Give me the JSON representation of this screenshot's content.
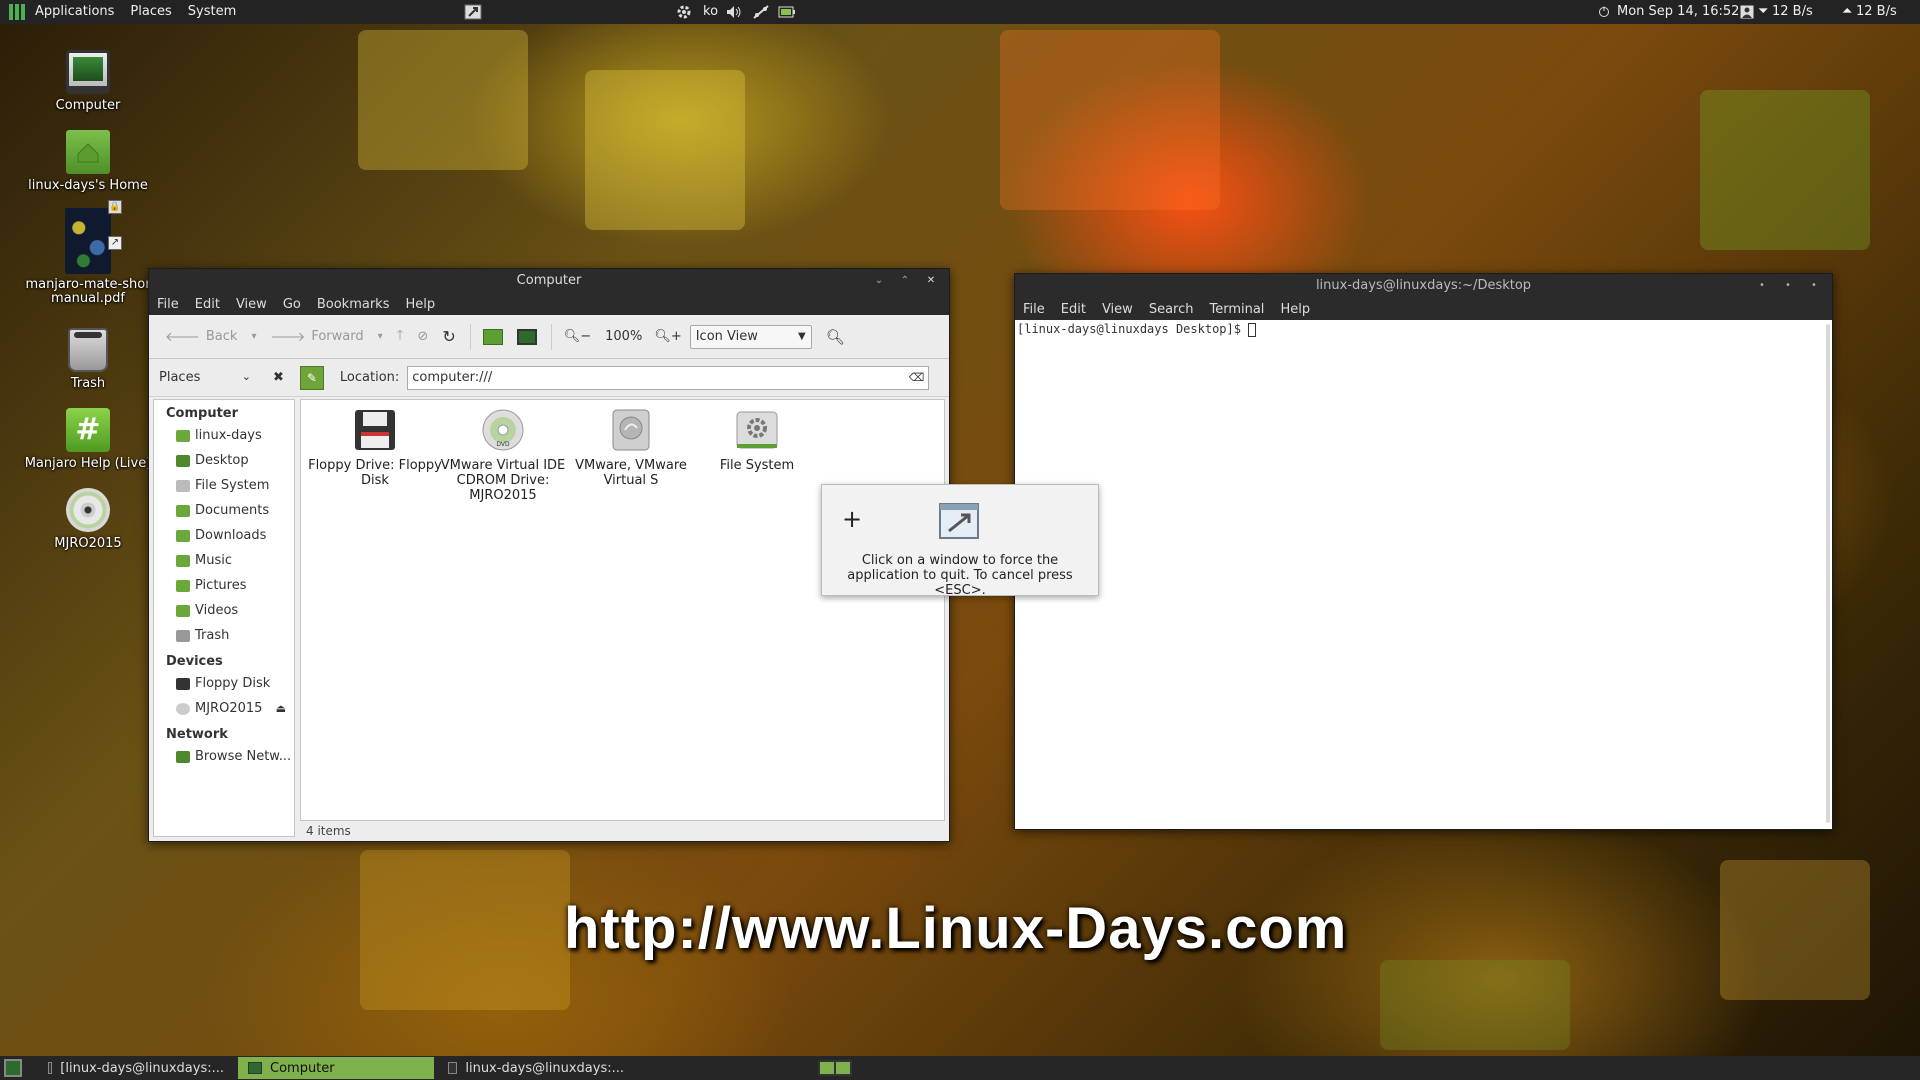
{
  "top_panel": {
    "menus": [
      "Applications",
      "Places",
      "System"
    ],
    "keyboard_layout": "ko",
    "clock": "Mon Sep 14, 16:52",
    "net_down": "12 B/s",
    "net_up": "12 B/s"
  },
  "desktop_icons": [
    {
      "label": "Computer"
    },
    {
      "label": "linux-days's Home"
    },
    {
      "label": "manjaro-mate-shortcuts-manual.pdf",
      "display": "manjaro-mate-shor\nmanual.pdf"
    },
    {
      "label": "Trash"
    },
    {
      "label": "Manjaro Help (Live)"
    },
    {
      "label": "MJRO2015"
    }
  ],
  "file_manager": {
    "title": "Computer",
    "menus": [
      "File",
      "Edit",
      "View",
      "Go",
      "Bookmarks",
      "Help"
    ],
    "toolbar": {
      "back": "Back",
      "forward": "Forward",
      "zoom": "100%",
      "view_mode": "Icon View"
    },
    "sidebar_selector": "Places",
    "location_label": "Location:",
    "location_value": "computer:///",
    "sidebar": {
      "computer_header": "Computer",
      "computer_items": [
        "linux-days",
        "Desktop",
        "File System",
        "Documents",
        "Downloads",
        "Music",
        "Pictures",
        "Videos",
        "Trash"
      ],
      "devices_header": "Devices",
      "device_items": [
        "Floppy Disk",
        "MJRO2015"
      ],
      "network_header": "Network",
      "network_items": [
        "Browse Netw..."
      ]
    },
    "files": [
      {
        "label": "Floppy Drive: Floppy Disk"
      },
      {
        "label": "VMware Virtual IDE CDROM Drive: MJRO2015"
      },
      {
        "label": "VMware, VMware Virtual S"
      },
      {
        "label": "File System"
      }
    ],
    "status": "4 items"
  },
  "force_quit_popup": {
    "text": "Click on a window to force the application to quit. To cancel press <ESC>."
  },
  "terminal": {
    "title": "linux-days@linuxdays:~/Desktop",
    "menus": [
      "File",
      "Edit",
      "View",
      "Search",
      "Terminal",
      "Help"
    ],
    "prompt": "[linux-days@linuxdays Desktop]$ "
  },
  "watermark": "http://www.Linux-Days.com",
  "taskbar": {
    "tasks": [
      {
        "label": "[linux-days@linuxdays:..."
      },
      {
        "label": "Computer"
      },
      {
        "label": "linux-days@linuxdays:..."
      }
    ]
  },
  "colors": {
    "accent": "#7fb24c",
    "panel": "#232323"
  }
}
